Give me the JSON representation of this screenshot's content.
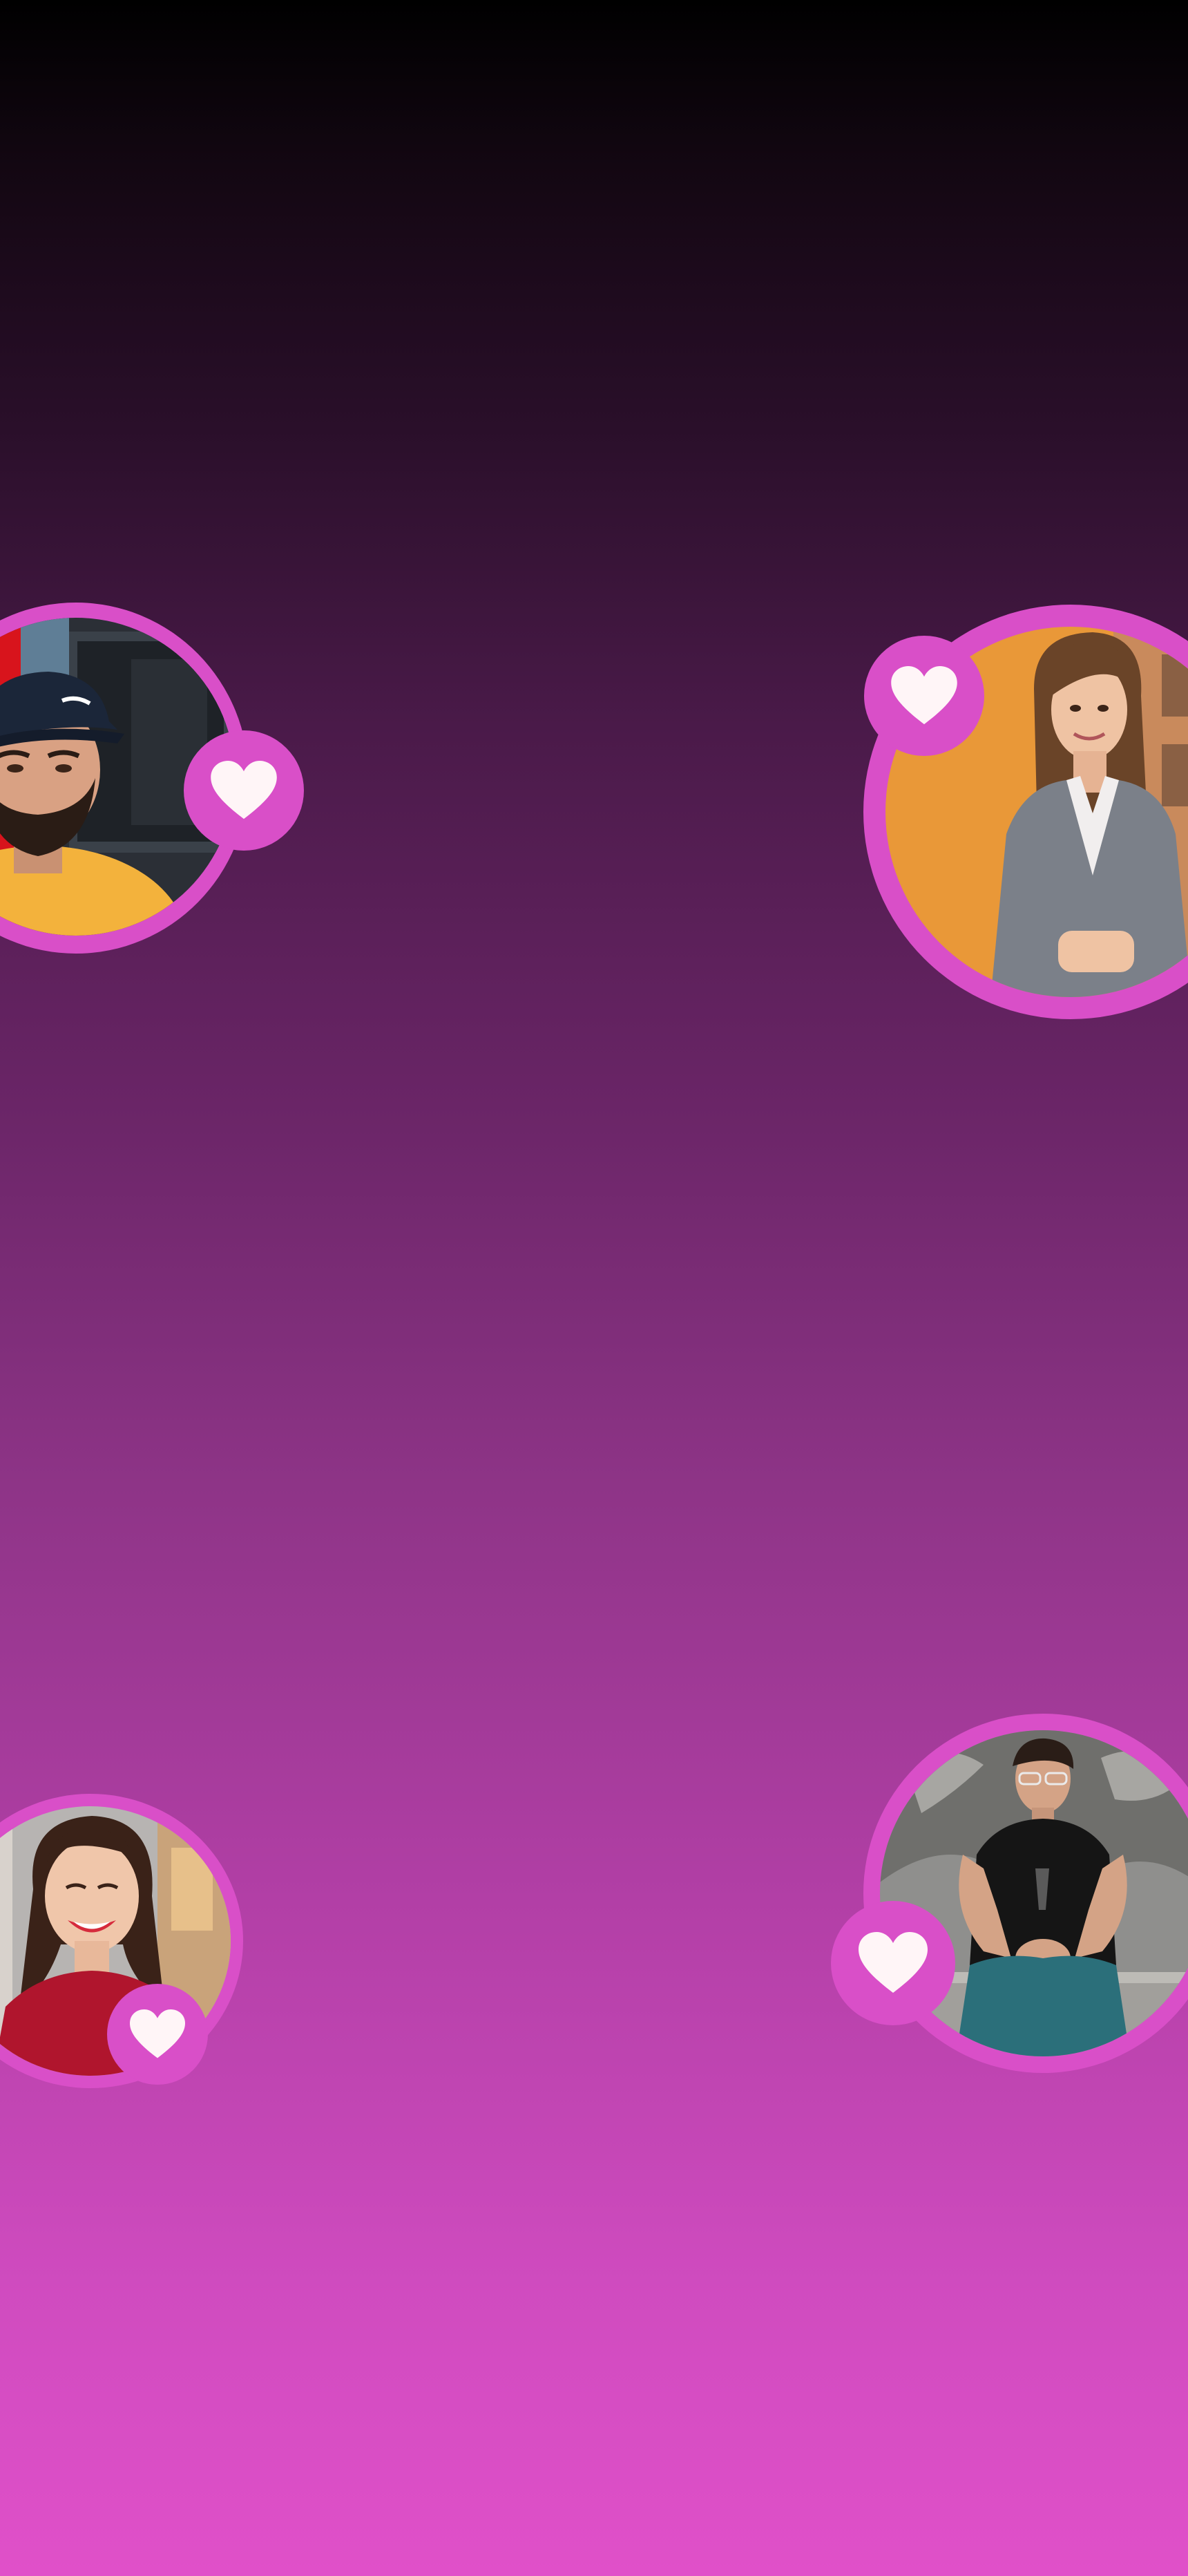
{
  "screen": {
    "name": "matching-background",
    "gradient_colors": [
      "#000000",
      "#2a0f2a",
      "#6a2567",
      "#b23fa6",
      "#e050c9"
    ]
  },
  "accent_color": "#d94fc8",
  "heart_color": "#fff5f7",
  "profiles": [
    {
      "id": "profile-1",
      "photo": "man-with-cap-photo",
      "badge_icon": "heart-icon"
    },
    {
      "id": "profile-2",
      "photo": "woman-in-blazer-photo",
      "badge_icon": "heart-icon"
    },
    {
      "id": "profile-3",
      "photo": "laughing-woman-photo",
      "badge_icon": "heart-icon"
    },
    {
      "id": "profile-4",
      "photo": "man-on-fountain-photo",
      "badge_icon": "heart-icon"
    }
  ]
}
